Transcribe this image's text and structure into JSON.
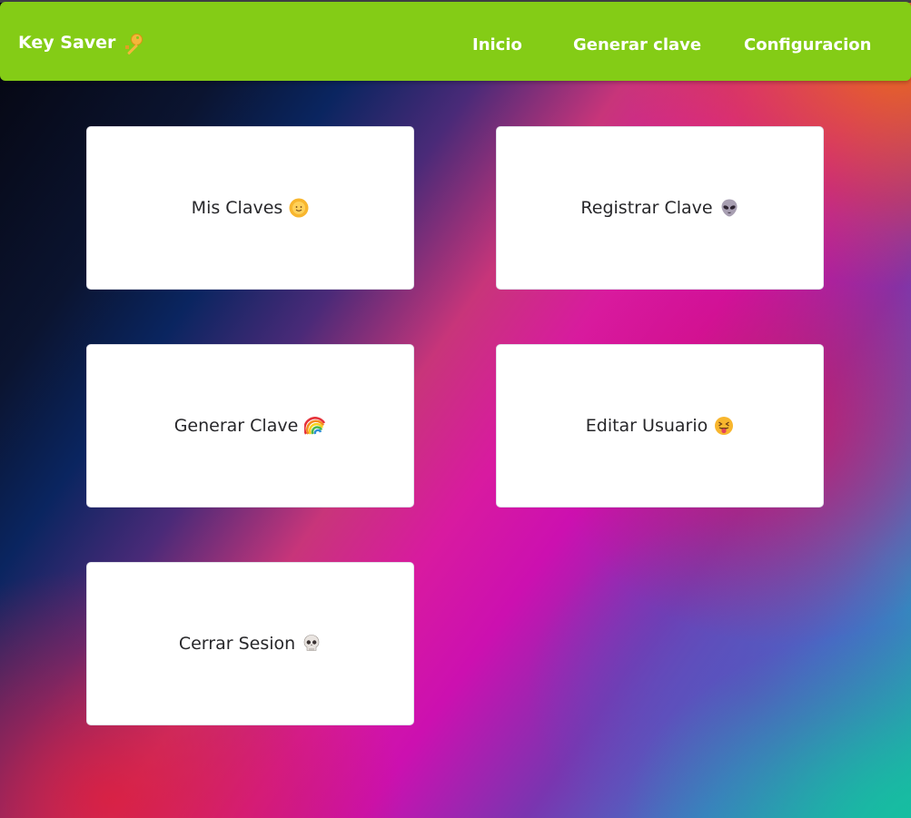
{
  "navbar": {
    "brand": "Key Saver",
    "brand_icon": "key-icon",
    "links": [
      "Inicio",
      "Generar clave",
      "Configuracion"
    ],
    "color": "#84cc16"
  },
  "cards": [
    {
      "label": "Mis Claves",
      "icon": "sun-with-face-icon"
    },
    {
      "label": "Registrar Clave",
      "icon": "alien-icon"
    },
    {
      "label": "Generar Clave",
      "icon": "rainbow-icon"
    },
    {
      "label": "Editar Usuario",
      "icon": "tongue-out-face-icon"
    },
    {
      "label": "Cerrar Sesion",
      "icon": "skull-icon"
    }
  ]
}
